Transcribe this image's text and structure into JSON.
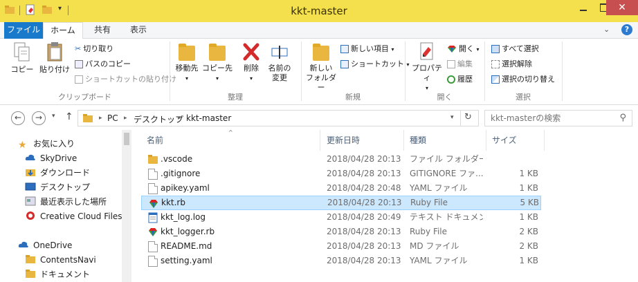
{
  "window": {
    "title": "kkt-master",
    "close_glyph": "✕"
  },
  "ribbon_tabs": {
    "file": "ファイル",
    "home": "ホーム",
    "share": "共有",
    "view": "表示"
  },
  "ribbon": {
    "clipboard": {
      "copy": "コピー",
      "paste": "貼り付け",
      "cut": "切り取り",
      "copy_path": "パスのコピー",
      "paste_shortcut": "ショートカットの貼り付け",
      "label": "クリップボード"
    },
    "organize": {
      "move_to": "移動先",
      "copy_to": "コピー先",
      "delete": "削除",
      "rename_line1": "名前の",
      "rename_line2": "変更",
      "label": "整理"
    },
    "new": {
      "new_folder_line1": "新しい",
      "new_folder_line2": "フォルダー",
      "new_item": "新しい項目",
      "shortcut": "ショートカット",
      "label": "新規"
    },
    "open": {
      "properties": "プロパティ",
      "open": "開く",
      "edit": "編集",
      "history": "履歴",
      "label": "開く"
    },
    "select": {
      "select_all": "すべて選択",
      "select_none": "選択解除",
      "invert": "選択の切り替え",
      "label": "選択"
    }
  },
  "address": {
    "crumbs": [
      "PC",
      "デスクトップ",
      "kkt-master"
    ],
    "search_placeholder": "kkt-masterの検索"
  },
  "nav": {
    "favorites": "お気に入り",
    "skydrive": "SkyDrive",
    "downloads": "ダウンロード",
    "desktop": "デスクトップ",
    "recent": "最近表示した場所",
    "creative_cloud": "Creative Cloud Files",
    "onedrive": "OneDrive",
    "contentsnavi": "ContentsNavi",
    "documents": "ドキュメント"
  },
  "columns": {
    "name": "名前",
    "date": "更新日時",
    "type": "種類",
    "size": "サイズ"
  },
  "files": [
    {
      "name": ".vscode",
      "date": "2018/04/28 20:13",
      "type": "ファイル フォルダー",
      "size": "",
      "icon": "folder"
    },
    {
      "name": ".gitignore",
      "date": "2018/04/28 20:13",
      "type": "GITIGNORE ファ...",
      "size": "1 KB",
      "icon": "file"
    },
    {
      "name": "apikey.yaml",
      "date": "2018/04/28 20:48",
      "type": "YAML ファイル",
      "size": "1 KB",
      "icon": "file"
    },
    {
      "name": "kkt.rb",
      "date": "2018/04/28 20:13",
      "type": "Ruby File",
      "size": "5 KB",
      "icon": "ruby"
    },
    {
      "name": "kkt_log.log",
      "date": "2018/04/28 20:49",
      "type": "テキスト ドキュメント",
      "size": "1 KB",
      "icon": "text"
    },
    {
      "name": "kkt_logger.rb",
      "date": "2018/04/28 20:13",
      "type": "Ruby File",
      "size": "2 KB",
      "icon": "ruby"
    },
    {
      "name": "README.md",
      "date": "2018/04/28 20:13",
      "type": "MD ファイル",
      "size": "2 KB",
      "icon": "file"
    },
    {
      "name": "setting.yaml",
      "date": "2018/04/28 20:13",
      "type": "YAML ファイル",
      "size": "1 KB",
      "icon": "file"
    }
  ],
  "selected_file": "kkt.rb",
  "colors": {
    "title_bar": "#f4df4d",
    "file_tab": "#1979ca",
    "selection": "#cce8ff",
    "folder": "#e9b73f"
  }
}
